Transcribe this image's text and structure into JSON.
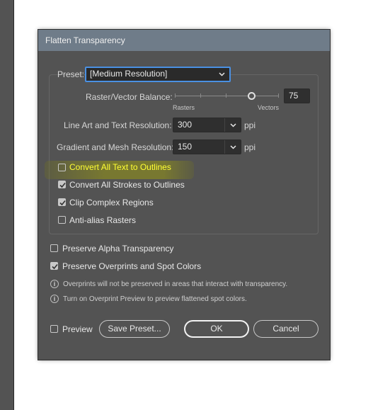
{
  "dialog": {
    "title": "Flatten Transparency",
    "preset_label": "Preset:",
    "preset_value": "[Medium Resolution]",
    "balance_label": "Raster/Vector Balance:",
    "balance_value": "75",
    "balance_min_label": "Rasters",
    "balance_max_label": "Vectors",
    "line_art_label": "Line Art and Text Resolution:",
    "line_art_value": "300",
    "line_art_unit": "ppi",
    "gradient_label": "Gradient and Mesh Resolution:",
    "gradient_value": "150",
    "gradient_unit": "ppi",
    "options": [
      {
        "label": "Convert All Text to Outlines",
        "checked": false
      },
      {
        "label": "Convert All Strokes to Outlines",
        "checked": true
      },
      {
        "label": "Clip Complex Regions",
        "checked": true
      },
      {
        "label": "Anti-alias Rasters",
        "checked": false
      }
    ],
    "preserve_alpha_label": "Preserve Alpha Transparency",
    "preserve_alpha_checked": false,
    "preserve_overprints_label": "Preserve Overprints and Spot Colors",
    "preserve_overprints_checked": true,
    "info_1": "Overprints will not be preserved in areas that interact with transparency.",
    "info_2": "Turn on Overprint Preview to preview flattened spot colors.",
    "preview_label": "Preview",
    "preview_checked": false,
    "save_preset_label": "Save Preset...",
    "ok_label": "OK",
    "cancel_label": "Cancel",
    "info_icon_glyph": "i",
    "highlight_color": "#ffff33",
    "accent_color": "#4a90e2"
  }
}
